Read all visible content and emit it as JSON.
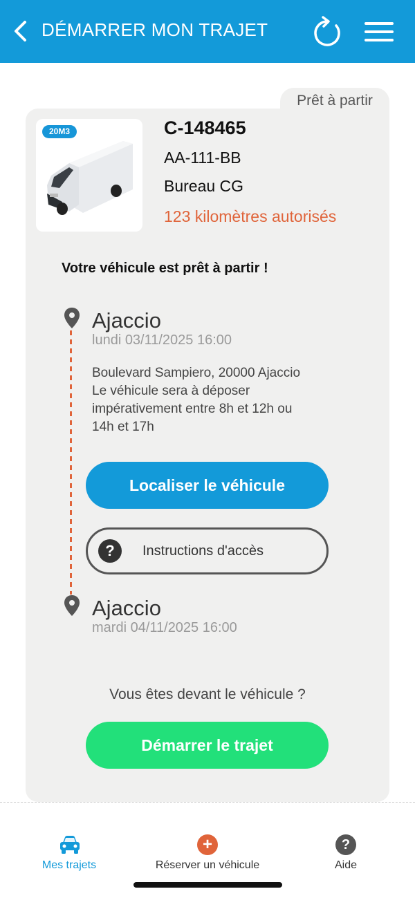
{
  "header": {
    "title": "DÉMARRER MON TRAJET"
  },
  "status_tab": "Prêt à partir",
  "vehicle": {
    "badge": "20M3",
    "contract": "C-148465",
    "plate": "AA-111-BB",
    "agency": "Bureau CG",
    "km_allowed": "123 kilomètres autorisés"
  },
  "ready_message": "Votre véhicule est prêt à partir !",
  "departure": {
    "city": "Ajaccio",
    "date": "lundi 03/11/2025 16:00",
    "address_lines": [
      "Boulevard Sampiero, 20000 Ajaccio",
      "Le véhicule sera à déposer",
      "impérativement entre 8h et 12h ou",
      "14h et 17h"
    ]
  },
  "buttons": {
    "locate": "Localiser le véhicule",
    "access": "Instructions d'accès",
    "start": "Démarrer le trajet"
  },
  "arrival": {
    "city": "Ajaccio",
    "date": "mardi 04/11/2025 16:00"
  },
  "question": "Vous êtes devant le véhicule ?",
  "bottom_nav": {
    "items": [
      {
        "label": "Mes trajets",
        "icon": "car-icon",
        "active": true
      },
      {
        "label": "Réserver un véhicule",
        "icon": "plus-icon",
        "active": false
      },
      {
        "label": "Aide",
        "icon": "help-icon",
        "active": false
      }
    ]
  },
  "colors": {
    "primary": "#139ad9",
    "accent": "#e0643a",
    "start": "#22e07a",
    "card": "#f0f0ef"
  }
}
